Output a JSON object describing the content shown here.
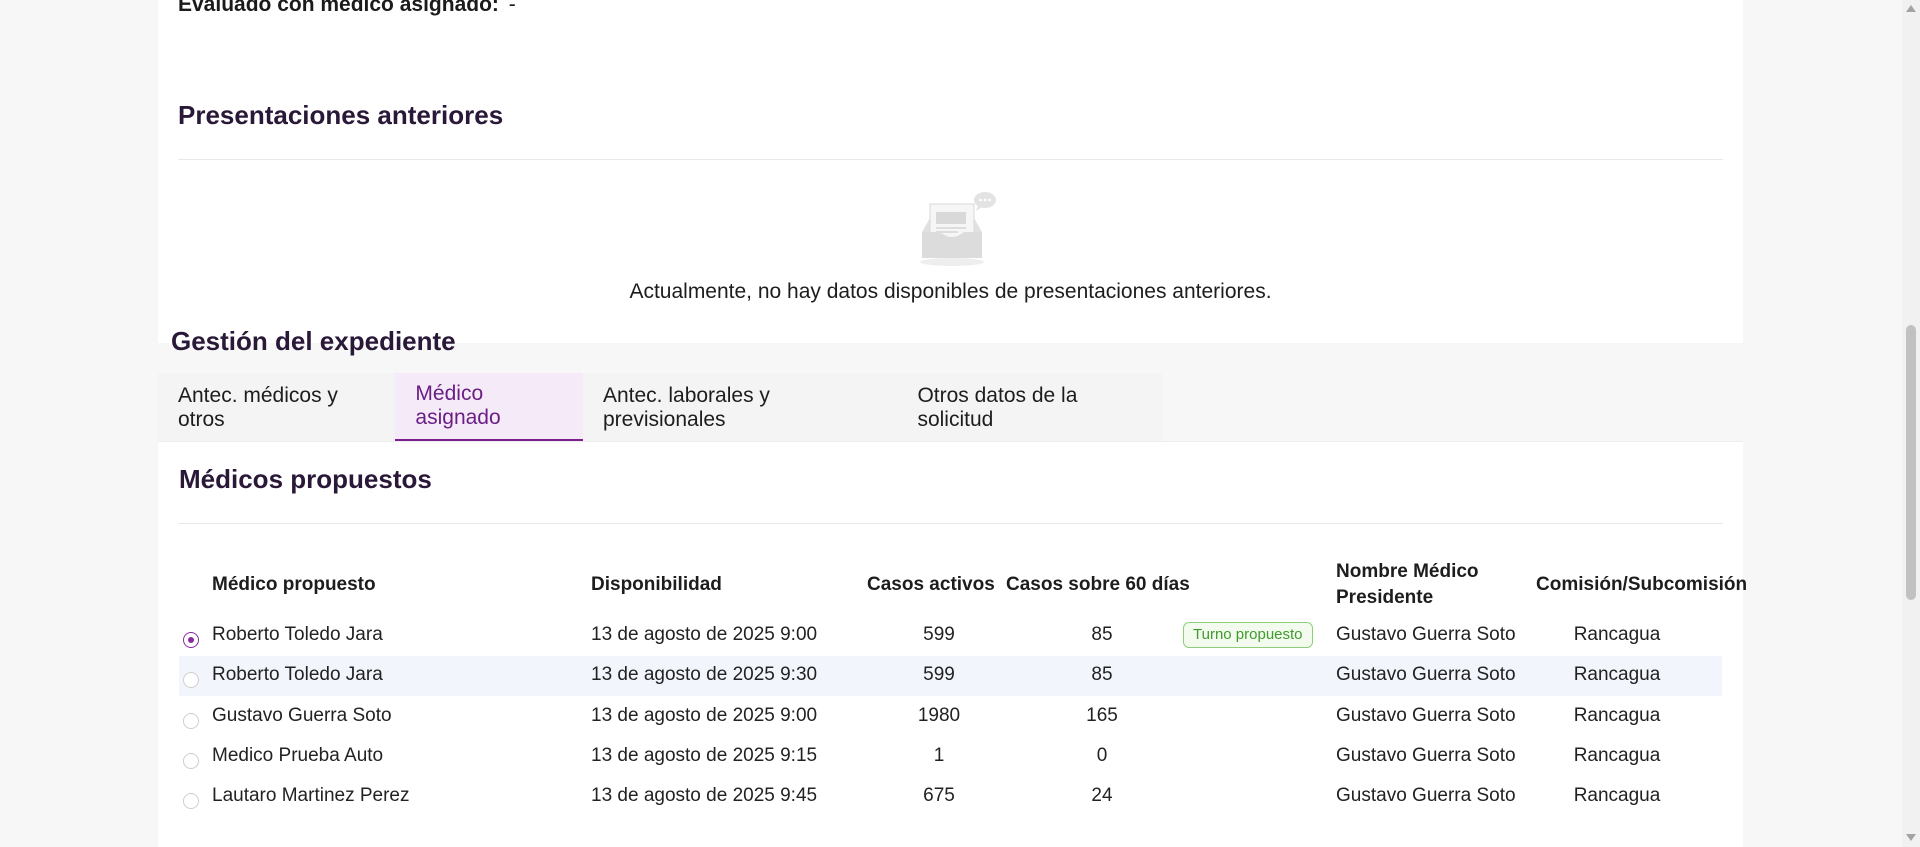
{
  "evaluado": {
    "label": "Evaluado con médico asignado:",
    "value": "-"
  },
  "presentaciones": {
    "title": "Presentaciones anteriores",
    "empty_message": "Actualmente, no hay datos disponibles de presentaciones anteriores.",
    "empty_icon": "inbox-icon"
  },
  "gestion": {
    "title": "Gestión del expediente",
    "tabs": [
      {
        "label": "Antec. médicos y otros",
        "active": false
      },
      {
        "label": "Médico asignado",
        "active": true
      },
      {
        "label": "Antec. laborales y previsionales",
        "active": false
      },
      {
        "label": "Otros datos de la solicitud",
        "active": false
      }
    ]
  },
  "medicos": {
    "title": "Médicos propuestos",
    "columns": {
      "medico": "Médico propuesto",
      "disponibilidad": "Disponibilidad",
      "casos_activos": "Casos activos",
      "casos_60": "Casos sobre 60 días",
      "presidente": "Nombre Médico Presidente",
      "comision": "Comisión/Subcomisión"
    },
    "rows": [
      {
        "medico": "Roberto Toledo Jara",
        "disponibilidad": "13 de agosto de 2025 9:00",
        "casos_activos": "599",
        "casos_60": "85",
        "badge": "Turno propuesto",
        "presidente": "Gustavo Guerra Soto",
        "comision": "Rancagua",
        "selected": true
      },
      {
        "medico": "Roberto Toledo Jara",
        "disponibilidad": "13 de agosto de 2025 9:30",
        "casos_activos": "599",
        "casos_60": "85",
        "badge": "",
        "presidente": "Gustavo Guerra Soto",
        "comision": "Rancagua",
        "selected": false
      },
      {
        "medico": "Gustavo Guerra Soto",
        "disponibilidad": "13 de agosto de 2025 9:00",
        "casos_activos": "1980",
        "casos_60": "165",
        "badge": "",
        "presidente": "Gustavo Guerra Soto",
        "comision": "Rancagua",
        "selected": false
      },
      {
        "medico": "Medico Prueba Auto",
        "disponibilidad": "13 de agosto de 2025 9:15",
        "casos_activos": "1",
        "casos_60": "0",
        "badge": "",
        "presidente": "Gustavo Guerra Soto",
        "comision": "Rancagua",
        "selected": false
      },
      {
        "medico": "Lautaro Martinez Perez",
        "disponibilidad": "13 de agosto de 2025 9:45",
        "casos_activos": "675",
        "casos_60": "24",
        "badge": "",
        "presidente": "Gustavo Guerra Soto",
        "comision": "Rancagua",
        "selected": false
      }
    ]
  },
  "colors": {
    "accent": "#7b1f8f",
    "title": "#2a1838",
    "badge_green": "#3f9b2c",
    "row_highlight": "#f2f6fc"
  }
}
